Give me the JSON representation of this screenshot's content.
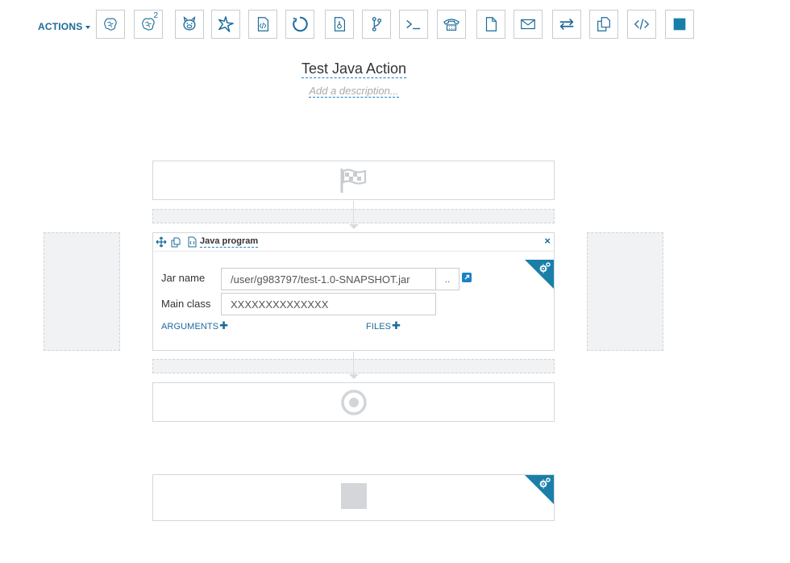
{
  "toolbar": {
    "actions_label": "ACTIONS",
    "buttons": [
      {
        "name": "hive-icon",
        "sup": ""
      },
      {
        "name": "hive2-icon",
        "sup": "2"
      },
      {
        "name": "pig-icon",
        "sup": ""
      },
      {
        "name": "spark-icon",
        "sup": ""
      },
      {
        "name": "java-icon",
        "sup": ""
      },
      {
        "name": "sqoop-icon",
        "sup": ""
      },
      {
        "name": "mapreduce-icon",
        "sup": ""
      },
      {
        "name": "subworkflow-icon",
        "sup": ""
      },
      {
        "name": "shell-icon",
        "sup": ""
      },
      {
        "name": "ssh-icon",
        "sup": ""
      },
      {
        "name": "hdfs-fs-icon",
        "sup": ""
      },
      {
        "name": "email-icon",
        "sup": ""
      },
      {
        "name": "streaming-icon",
        "sup": ""
      },
      {
        "name": "distcp-icon",
        "sup": ""
      },
      {
        "name": "generic-icon",
        "sup": ""
      },
      {
        "name": "kill-icon",
        "sup": ""
      }
    ]
  },
  "workflow": {
    "title": "Test Java Action",
    "description_placeholder": "Add a description..."
  },
  "java_action": {
    "title": "Java program",
    "close_glyph": "×",
    "jar_name_label": "Jar name",
    "jar_name_value": "/user/g983797/test-1.0-SNAPSHOT.jar",
    "browse_label": "..",
    "main_class_label": "Main class",
    "main_class_value": "XXXXXXXXXXXXXX",
    "arguments_label": "ARGUMENTS",
    "files_label": "FILES"
  },
  "colors": {
    "accent": "#1a6b9a",
    "corner": "#1a7fa8",
    "border": "#c8ccd0",
    "drop_zone": "#f1f2f4"
  }
}
